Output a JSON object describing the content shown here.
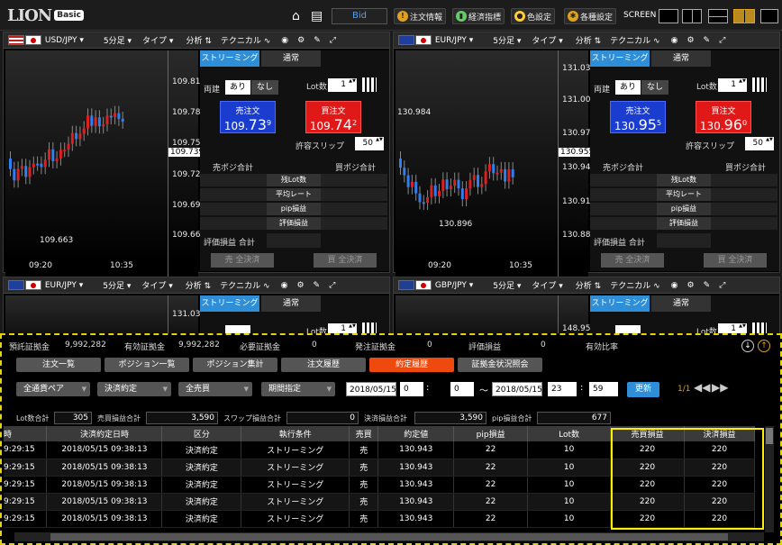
{
  "app": {
    "logo": "LION",
    "edition": "Basic"
  },
  "topbar": {
    "price_mode": "Bid",
    "buttons": [
      "注文情報",
      "経済指標",
      "色設定",
      "各種設定"
    ],
    "screen_label": "SCREEN"
  },
  "panels": [
    {
      "pair": "USD/JPY",
      "timeframe": "5分足",
      "type_label": "タイプ",
      "analysis_label": "分析",
      "technical_label": "テクニカル",
      "yticks": [
        "109.810",
        "109.780",
        "109.750",
        "109.720",
        "109.690",
        "109.660"
      ],
      "current": "109.739",
      "high_label": "",
      "low_label": "109.663",
      "xticks": [
        "09:20",
        "10:35"
      ],
      "sell_price": {
        "pre": "109.",
        "big": "73",
        "sup": "9"
      },
      "buy_price": {
        "pre": "109.",
        "big": "74",
        "sup": "2"
      },
      "lot": "1",
      "slip": "50"
    },
    {
      "pair": "EUR/JPY",
      "timeframe": "5分足",
      "type_label": "タイプ",
      "analysis_label": "分析",
      "technical_label": "テクニカル",
      "yticks": [
        "131.030",
        "131.000",
        "130.970",
        "130.940",
        "130.910",
        "130.880"
      ],
      "current": "130.955",
      "high_label": "130.984",
      "low_label": "130.896",
      "xticks": [
        "09:20",
        "10:35"
      ],
      "sell_price": {
        "pre": "130.",
        "big": "95",
        "sup": "5"
      },
      "buy_price": {
        "pre": "130.",
        "big": "96",
        "sup": "0"
      },
      "lot": "1",
      "slip": "50"
    }
  ],
  "mini_panels": [
    {
      "pair": "EUR/JPY",
      "timeframe": "5分足",
      "type_label": "タイプ",
      "analysis_label": "分析",
      "technical_label": "テクニカル",
      "ytick": "131.030",
      "lot": "1"
    },
    {
      "pair": "GBP/JPY",
      "timeframe": "5分足",
      "type_label": "タイプ",
      "analysis_label": "分析",
      "technical_label": "テクニカル",
      "ytick": "148.950",
      "lot": "1"
    }
  ],
  "order_panel": {
    "tab_streaming": "ストリーミング",
    "tab_normal": "通常",
    "both_label": "両建",
    "yes": "あり",
    "no": "なし",
    "lot_label": "Lot数",
    "sell_label": "売注文",
    "buy_label": "買注文",
    "slippage_label": "許容スリップ",
    "sell_pos_total": "売ポジ合計",
    "buy_pos_total": "買ポジ合計",
    "rows": [
      "残Lot数",
      "平均レート",
      "pip損益",
      "評価損益"
    ],
    "eval_total": "評価損益 合計",
    "sell_close_all": "売 全決済",
    "buy_close_all": "買 全決済"
  },
  "account": {
    "deposit_label": "預託証拠金",
    "deposit": "9,992,282",
    "effective_label": "有効証拠金",
    "effective": "9,992,282",
    "required_label": "必要証拠金",
    "required": "0",
    "ordered_label": "発注証拠金",
    "ordered": "0",
    "eval_label": "評価損益",
    "eval": "0",
    "ratio_label": "有効比率",
    "ratio": ""
  },
  "tabs": [
    "注文一覧",
    "ポジション一覧",
    "ポジション集計",
    "注文履歴",
    "約定履歴",
    "証拠金状況照会"
  ],
  "active_tab": "約定履歴",
  "filters": {
    "pair": "全通貨ペア",
    "kind": "決済約定",
    "side": "全売買",
    "period": "期間指定",
    "date_from": "2018/05/15",
    "h_from": "0",
    "m_from": "0",
    "tilde": "～",
    "date_to": "2018/05/15",
    "h_to": "23",
    "m_to": "59",
    "update": "更新",
    "page": "1/1",
    "colon": ":"
  },
  "totals": {
    "lots_label": "Lot数合計",
    "lots": "305",
    "trade_pl_label": "売買損益合計",
    "trade_pl": "3,590",
    "swap_label": "スワップ損益合計",
    "swap": "0",
    "settle_label": "決済損益合計",
    "settle": "3,590",
    "pip_label": "pip損益合計",
    "pip": "677"
  },
  "table": {
    "headers": [
      "時",
      "決済約定日時",
      "区分",
      "執行条件",
      "売買",
      "約定値",
      "pip損益",
      "Lot数",
      "売買損益",
      "決済損益"
    ],
    "rows": [
      [
        "9:29:15",
        "2018/05/15 09:38:13",
        "決済約定",
        "ストリーミング",
        "売",
        "130.943",
        "22",
        "10",
        "220",
        "220"
      ],
      [
        "9:29:15",
        "2018/05/15 09:38:13",
        "決済約定",
        "ストリーミング",
        "売",
        "130.943",
        "22",
        "10",
        "220",
        "220"
      ],
      [
        "9:29:15",
        "2018/05/15 09:38:13",
        "決済約定",
        "ストリーミング",
        "売",
        "130.943",
        "22",
        "10",
        "220",
        "220"
      ],
      [
        "9:29:15",
        "2018/05/15 09:38:13",
        "決済約定",
        "ストリーミング",
        "売",
        "130.943",
        "22",
        "10",
        "220",
        "220"
      ],
      [
        "9:29:15",
        "2018/05/15 09:38:13",
        "決済約定",
        "ストリーミング",
        "売",
        "130.943",
        "22",
        "10",
        "220",
        "220"
      ]
    ]
  },
  "colors": {
    "accent": "#2e8fd8",
    "sell": "#1a3ccf",
    "buy": "#e01818",
    "active_tab": "#ee4a10",
    "highlight": "#ffee00"
  }
}
